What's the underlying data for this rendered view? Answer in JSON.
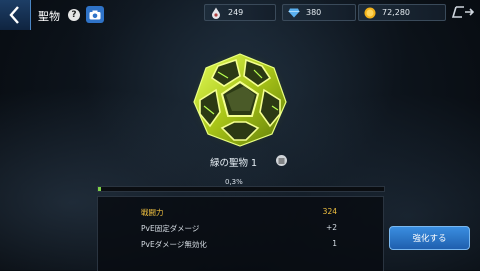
{
  "header": {
    "title": "聖物",
    "help_glyph": "?"
  },
  "resources": {
    "stamina": "249",
    "gems": "380",
    "gold": "72,280"
  },
  "relic": {
    "name": "緑の聖物 1",
    "color": "#c8e63a",
    "progress_text": "0,3%",
    "progress": 0.003
  },
  "stats": [
    {
      "label": "戦闘力",
      "value": "324"
    },
    {
      "label": "PvE固定ダメージ",
      "value": "+2"
    },
    {
      "label": "PvEダメージ無効化",
      "value": "1"
    }
  ],
  "actions": {
    "enhance_label": "強化する"
  },
  "colors": {
    "accent": "#2f73c8",
    "progress": "#7fd34a",
    "power": "#f0c040"
  }
}
